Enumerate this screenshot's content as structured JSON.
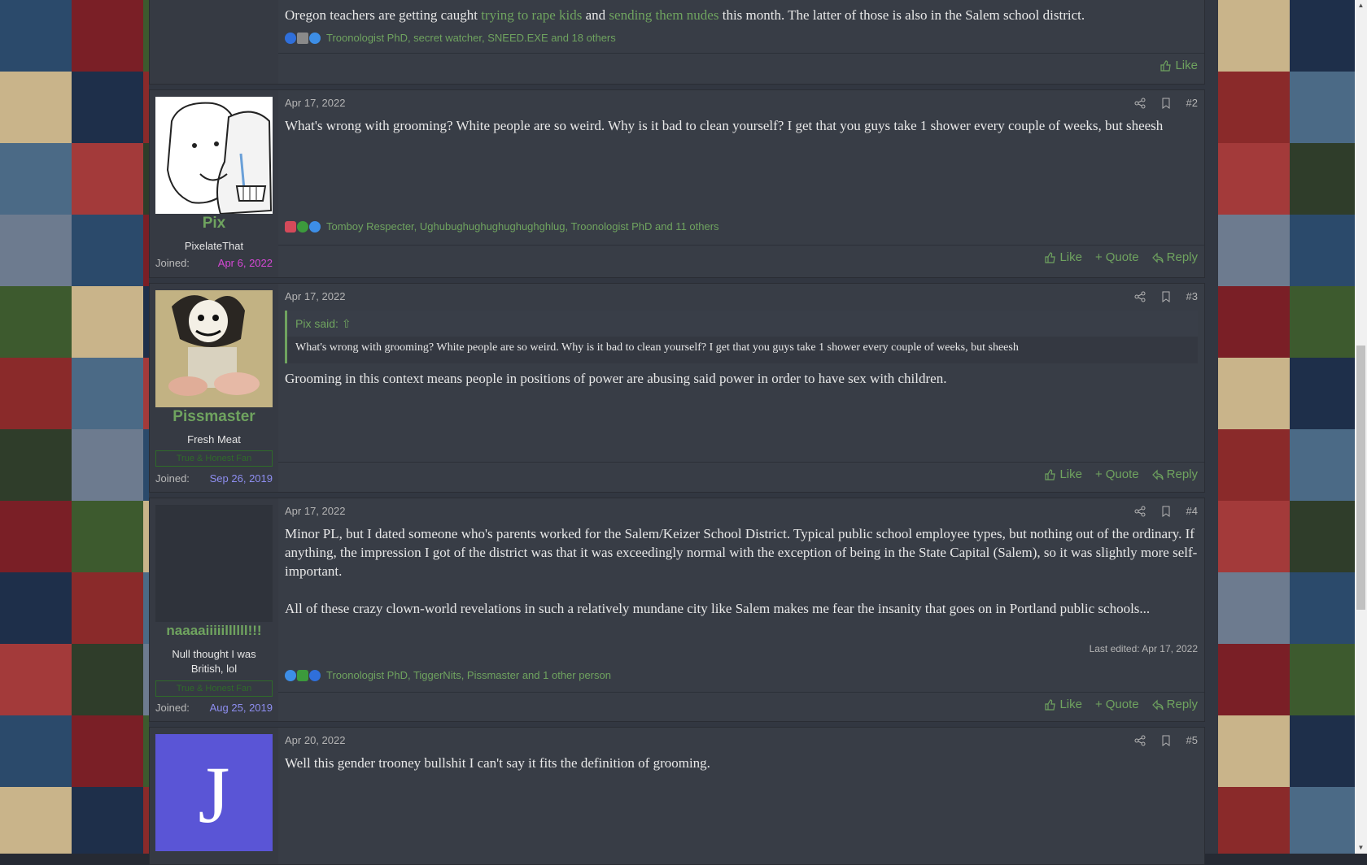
{
  "colors": {
    "accent": "#6fa35f",
    "page_bg": "#323741",
    "text": "#e8e8e8",
    "muted": "#b4b4b4",
    "joined_pix": "#d648d6",
    "joined_other": "#8e8ef0"
  },
  "post1": {
    "text_before": "Oregon teachers are getting caught ",
    "link1": "trying to rape kids",
    "text_mid": " and ",
    "link2": "sending them nudes",
    "text_after": " this month. The latter of those is also in the Salem school district.",
    "reactions": "Troonologist PhD, secret watcher, SNEED.EXE and 18 others",
    "like": "Like"
  },
  "post2": {
    "date": "Apr 17, 2022",
    "number": "#2",
    "username": "Pix",
    "usertitle": "PixelateThat",
    "joined_label": "Joined:",
    "joined_date": "Apr 6, 2022",
    "body": "What's wrong with grooming? White people are so weird. Why is it bad to clean yourself? I get that you guys take 1 shower every couple of weeks, but sheesh",
    "reactions": "Tomboy Respecter, Ughubughughughughughghlug, Troonologist PhD and 11 others",
    "like": "Like",
    "quote": "Quote",
    "reply": "Reply"
  },
  "post3": {
    "date": "Apr 17, 2022",
    "number": "#3",
    "username": "Pissmaster",
    "usertitle": "Fresh Meat",
    "banner": "True & Honest Fan",
    "joined_label": "Joined:",
    "joined_date": "Sep 26, 2019",
    "quote_author": "Pix said:",
    "quote_body": "What's wrong with grooming? White people are so weird. Why is it bad to clean yourself? I get that you guys take 1 shower every couple of weeks, but sheesh",
    "body": "Grooming in this context means people in positions of power are abusing said power in order to have sex with children.",
    "like": "Like",
    "quote": "Quote",
    "reply": "Reply"
  },
  "post4": {
    "date": "Apr 17, 2022",
    "number": "#4",
    "username": "naaaaiiiiillllll!!!",
    "usertitle_line1": "Null thought I was",
    "usertitle_line2": "British, lol",
    "banner": "True & Honest Fan",
    "joined_label": "Joined:",
    "joined_date": "Aug 25, 2019",
    "body_p1": "Minor PL, but I dated someone who's parents worked for the Salem/Keizer School District. Typical public school employee types, but nothing out of the ordinary. If anything, the impression I got of the district was that it was exceedingly normal with the exception of being in the State Capital (Salem), so it was slightly more self-important.",
    "body_p2": "All of these crazy clown-world revelations in such a relatively mundane city like Salem makes me fear the insanity that goes on in Portland public schools...",
    "edited": "Last edited: Apr 17, 2022",
    "reactions": "Troonologist PhD, TiggerNits, Pissmaster and 1 other person",
    "like": "Like",
    "quote": "Quote",
    "reply": "Reply"
  },
  "post5": {
    "date": "Apr 20, 2022",
    "number": "#5",
    "avatar_letter": "J",
    "body": "Well this gender trooney bullshit I can't say it fits the definition of grooming."
  }
}
